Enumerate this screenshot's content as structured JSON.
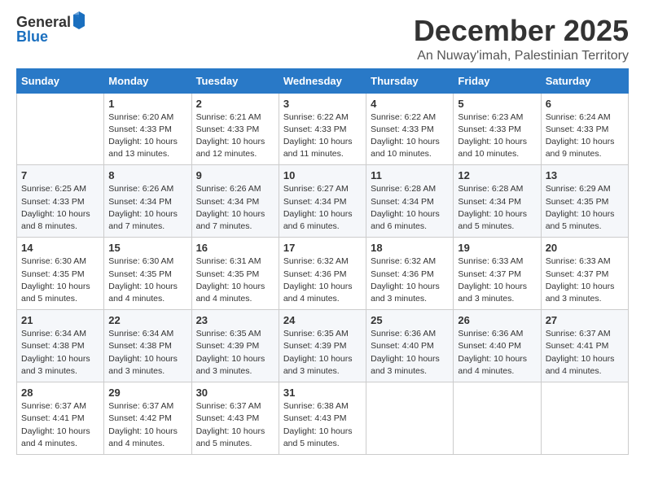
{
  "logo": {
    "general": "General",
    "blue": "Blue"
  },
  "title": "December 2025",
  "subtitle": "An Nuway'imah, Palestinian Territory",
  "headers": [
    "Sunday",
    "Monday",
    "Tuesday",
    "Wednesday",
    "Thursday",
    "Friday",
    "Saturday"
  ],
  "weeks": [
    [
      {
        "day": "",
        "info": ""
      },
      {
        "day": "1",
        "info": "Sunrise: 6:20 AM\nSunset: 4:33 PM\nDaylight: 10 hours\nand 13 minutes."
      },
      {
        "day": "2",
        "info": "Sunrise: 6:21 AM\nSunset: 4:33 PM\nDaylight: 10 hours\nand 12 minutes."
      },
      {
        "day": "3",
        "info": "Sunrise: 6:22 AM\nSunset: 4:33 PM\nDaylight: 10 hours\nand 11 minutes."
      },
      {
        "day": "4",
        "info": "Sunrise: 6:22 AM\nSunset: 4:33 PM\nDaylight: 10 hours\nand 10 minutes."
      },
      {
        "day": "5",
        "info": "Sunrise: 6:23 AM\nSunset: 4:33 PM\nDaylight: 10 hours\nand 10 minutes."
      },
      {
        "day": "6",
        "info": "Sunrise: 6:24 AM\nSunset: 4:33 PM\nDaylight: 10 hours\nand 9 minutes."
      }
    ],
    [
      {
        "day": "7",
        "info": "Sunrise: 6:25 AM\nSunset: 4:33 PM\nDaylight: 10 hours\nand 8 minutes."
      },
      {
        "day": "8",
        "info": "Sunrise: 6:26 AM\nSunset: 4:34 PM\nDaylight: 10 hours\nand 7 minutes."
      },
      {
        "day": "9",
        "info": "Sunrise: 6:26 AM\nSunset: 4:34 PM\nDaylight: 10 hours\nand 7 minutes."
      },
      {
        "day": "10",
        "info": "Sunrise: 6:27 AM\nSunset: 4:34 PM\nDaylight: 10 hours\nand 6 minutes."
      },
      {
        "day": "11",
        "info": "Sunrise: 6:28 AM\nSunset: 4:34 PM\nDaylight: 10 hours\nand 6 minutes."
      },
      {
        "day": "12",
        "info": "Sunrise: 6:28 AM\nSunset: 4:34 PM\nDaylight: 10 hours\nand 5 minutes."
      },
      {
        "day": "13",
        "info": "Sunrise: 6:29 AM\nSunset: 4:35 PM\nDaylight: 10 hours\nand 5 minutes."
      }
    ],
    [
      {
        "day": "14",
        "info": "Sunrise: 6:30 AM\nSunset: 4:35 PM\nDaylight: 10 hours\nand 5 minutes."
      },
      {
        "day": "15",
        "info": "Sunrise: 6:30 AM\nSunset: 4:35 PM\nDaylight: 10 hours\nand 4 minutes."
      },
      {
        "day": "16",
        "info": "Sunrise: 6:31 AM\nSunset: 4:35 PM\nDaylight: 10 hours\nand 4 minutes."
      },
      {
        "day": "17",
        "info": "Sunrise: 6:32 AM\nSunset: 4:36 PM\nDaylight: 10 hours\nand 4 minutes."
      },
      {
        "day": "18",
        "info": "Sunrise: 6:32 AM\nSunset: 4:36 PM\nDaylight: 10 hours\nand 3 minutes."
      },
      {
        "day": "19",
        "info": "Sunrise: 6:33 AM\nSunset: 4:37 PM\nDaylight: 10 hours\nand 3 minutes."
      },
      {
        "day": "20",
        "info": "Sunrise: 6:33 AM\nSunset: 4:37 PM\nDaylight: 10 hours\nand 3 minutes."
      }
    ],
    [
      {
        "day": "21",
        "info": "Sunrise: 6:34 AM\nSunset: 4:38 PM\nDaylight: 10 hours\nand 3 minutes."
      },
      {
        "day": "22",
        "info": "Sunrise: 6:34 AM\nSunset: 4:38 PM\nDaylight: 10 hours\nand 3 minutes."
      },
      {
        "day": "23",
        "info": "Sunrise: 6:35 AM\nSunset: 4:39 PM\nDaylight: 10 hours\nand 3 minutes."
      },
      {
        "day": "24",
        "info": "Sunrise: 6:35 AM\nSunset: 4:39 PM\nDaylight: 10 hours\nand 3 minutes."
      },
      {
        "day": "25",
        "info": "Sunrise: 6:36 AM\nSunset: 4:40 PM\nDaylight: 10 hours\nand 3 minutes."
      },
      {
        "day": "26",
        "info": "Sunrise: 6:36 AM\nSunset: 4:40 PM\nDaylight: 10 hours\nand 4 minutes."
      },
      {
        "day": "27",
        "info": "Sunrise: 6:37 AM\nSunset: 4:41 PM\nDaylight: 10 hours\nand 4 minutes."
      }
    ],
    [
      {
        "day": "28",
        "info": "Sunrise: 6:37 AM\nSunset: 4:41 PM\nDaylight: 10 hours\nand 4 minutes."
      },
      {
        "day": "29",
        "info": "Sunrise: 6:37 AM\nSunset: 4:42 PM\nDaylight: 10 hours\nand 4 minutes."
      },
      {
        "day": "30",
        "info": "Sunrise: 6:37 AM\nSunset: 4:43 PM\nDaylight: 10 hours\nand 5 minutes."
      },
      {
        "day": "31",
        "info": "Sunrise: 6:38 AM\nSunset: 4:43 PM\nDaylight: 10 hours\nand 5 minutes."
      },
      {
        "day": "",
        "info": ""
      },
      {
        "day": "",
        "info": ""
      },
      {
        "day": "",
        "info": ""
      }
    ]
  ]
}
